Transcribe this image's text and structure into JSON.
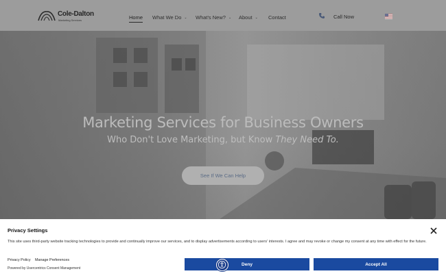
{
  "header": {
    "logo": {
      "name": "Cole-Dalton",
      "tagline": "Marketing Services"
    },
    "nav": [
      {
        "label": "Home",
        "has_dropdown": false,
        "active": true
      },
      {
        "label": "What We Do",
        "has_dropdown": true
      },
      {
        "label": "What's New?",
        "has_dropdown": true
      },
      {
        "label": "About",
        "has_dropdown": true
      },
      {
        "label": "Contact",
        "has_dropdown": false
      }
    ],
    "call_label": "Call Now",
    "icons": {
      "phone": "phone-icon",
      "flag": "us-flag-icon",
      "chevron": "chevron-down-icon"
    }
  },
  "hero": {
    "title": "Marketing Services for Business Owners",
    "subtitle_start": "Who Don't Love Marketing, but Know ",
    "subtitle_emphasis": "They Need To.",
    "cta_label": "See If We Can Help"
  },
  "consent": {
    "title": "Privacy Settings",
    "text": "This site uses third-party website tracking technologies to provide and continually improve our services, and to display advertisements according to users' interests. I agree and may revoke or change my consent at any time with effect for the future.",
    "links": {
      "privacy_policy": "Privacy Policy",
      "manage_preferences": "Manage Preferences"
    },
    "powered_by": "Powered by Usercentrics Consent Management",
    "deny_label": "Deny",
    "accept_label": "Accept All",
    "icons": {
      "close": "close-icon",
      "accessibility": "accessibility-icon"
    }
  },
  "colors": {
    "primary_button": "#1a4aa0",
    "overlay": "#9c9c9c",
    "cta_text": "#5a6b85"
  }
}
